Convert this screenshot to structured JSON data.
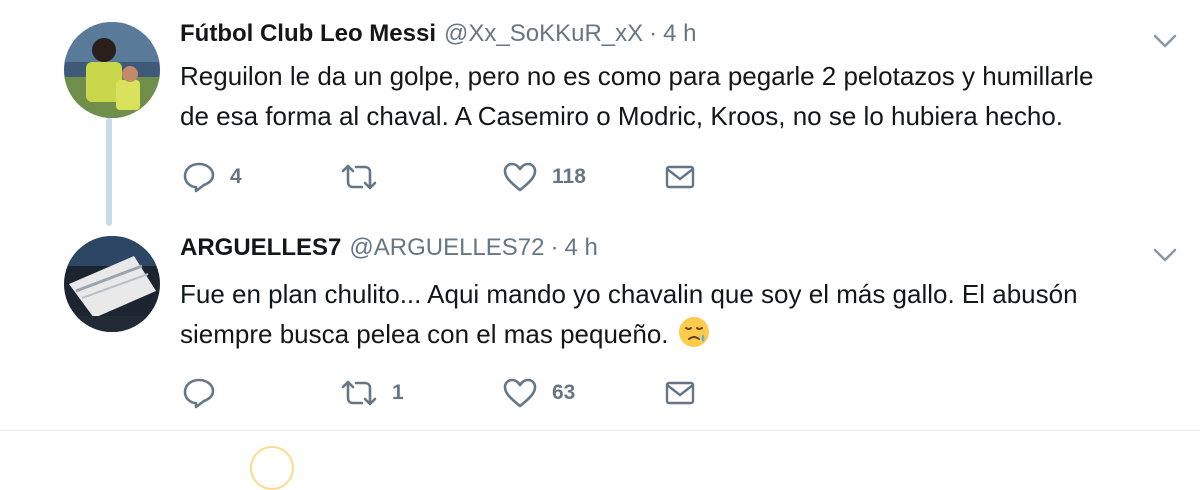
{
  "tweets": [
    {
      "name": "Fútbol Club Leo Messi",
      "handle": "@Xx_SoKKuR_xX",
      "separator": "·",
      "time": "4 h",
      "text_line1": "Reguilon le da un golpe, pero no es como para pegarle 2 pelotazos y humillarle",
      "text_line2": "de esa forma al chaval. A Casemiro o Modric, Kroos, no se lo hubiera hecho.",
      "replies": "4",
      "retweets": "",
      "likes": "118",
      "avatar_icon": "profile-photo-soccer-player"
    },
    {
      "name": "ARGUELLES7",
      "handle": "@ARGUELLES72",
      "separator": "·",
      "time": "4 h",
      "text_line1": "Fue en plan chulito... Aqui mando yo chavalin que soy el más gallo. El abusón",
      "text_line2": "siempre busca pelea con el mas pequeño.",
      "emoji": "sad-relieved-face-emoji",
      "replies": "",
      "retweets": "1",
      "likes": "63",
      "avatar_icon": "profile-photo-soccer-boot"
    }
  ],
  "colors": {
    "text": "#14171a",
    "muted": "#657786",
    "thread_line": "#c7dbe8",
    "divider": "#e6ecf0"
  },
  "icons": [
    "reply-icon",
    "retweet-icon",
    "like-icon",
    "direct-message-icon",
    "chevron-down-icon"
  ]
}
